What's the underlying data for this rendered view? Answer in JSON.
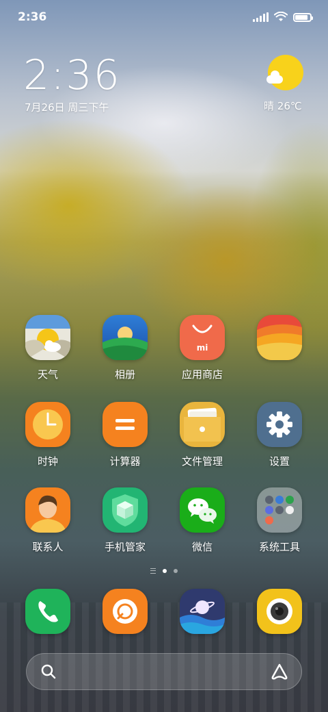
{
  "status_bar": {
    "time": "2:36",
    "icons": [
      "signal-icon",
      "wifi-icon",
      "battery-icon"
    ]
  },
  "clock_widget": {
    "time": "2:36",
    "date": "7月26日 周三下午"
  },
  "weather_widget": {
    "condition": "晴",
    "temperature": "26℃",
    "icon": "sun-cloud-icon"
  },
  "apps": [
    {
      "label": "天气",
      "icon": "weather-icon"
    },
    {
      "label": "相册",
      "icon": "gallery-icon"
    },
    {
      "label": "应用商店",
      "icon": "app-store-icon"
    },
    {
      "label": "",
      "icon": "themes-icon"
    },
    {
      "label": "时钟",
      "icon": "clock-icon"
    },
    {
      "label": "计算器",
      "icon": "calculator-icon"
    },
    {
      "label": "文件管理",
      "icon": "file-manager-icon"
    },
    {
      "label": "设置",
      "icon": "settings-icon"
    },
    {
      "label": "联系人",
      "icon": "contacts-icon"
    },
    {
      "label": "手机管家",
      "icon": "security-icon"
    },
    {
      "label": "微信",
      "icon": "wechat-icon"
    },
    {
      "label": "系统工具",
      "icon": "system-tools-folder-icon"
    }
  ],
  "page_indicator": {
    "pages": 2,
    "current": 1
  },
  "dock": [
    {
      "icon": "phone-icon"
    },
    {
      "icon": "browser-icon"
    },
    {
      "icon": "planet-browser-icon"
    },
    {
      "icon": "camera-icon"
    }
  ],
  "search_bar": {
    "left_icon": "search-icon",
    "right_icon": "assistant-icon"
  },
  "colors": {
    "weather_sun": "#f8d21b",
    "app_store": "#f06a4a",
    "clock": "#f5821f",
    "calculator": "#f5821f",
    "file_manager": "#e9b53d",
    "settings": "#4f6f8f",
    "security": "#22b573",
    "wechat": "#1aad19",
    "phone": "#1fb35a",
    "browser": "#f5821f",
    "camera": "#f2c21b"
  }
}
